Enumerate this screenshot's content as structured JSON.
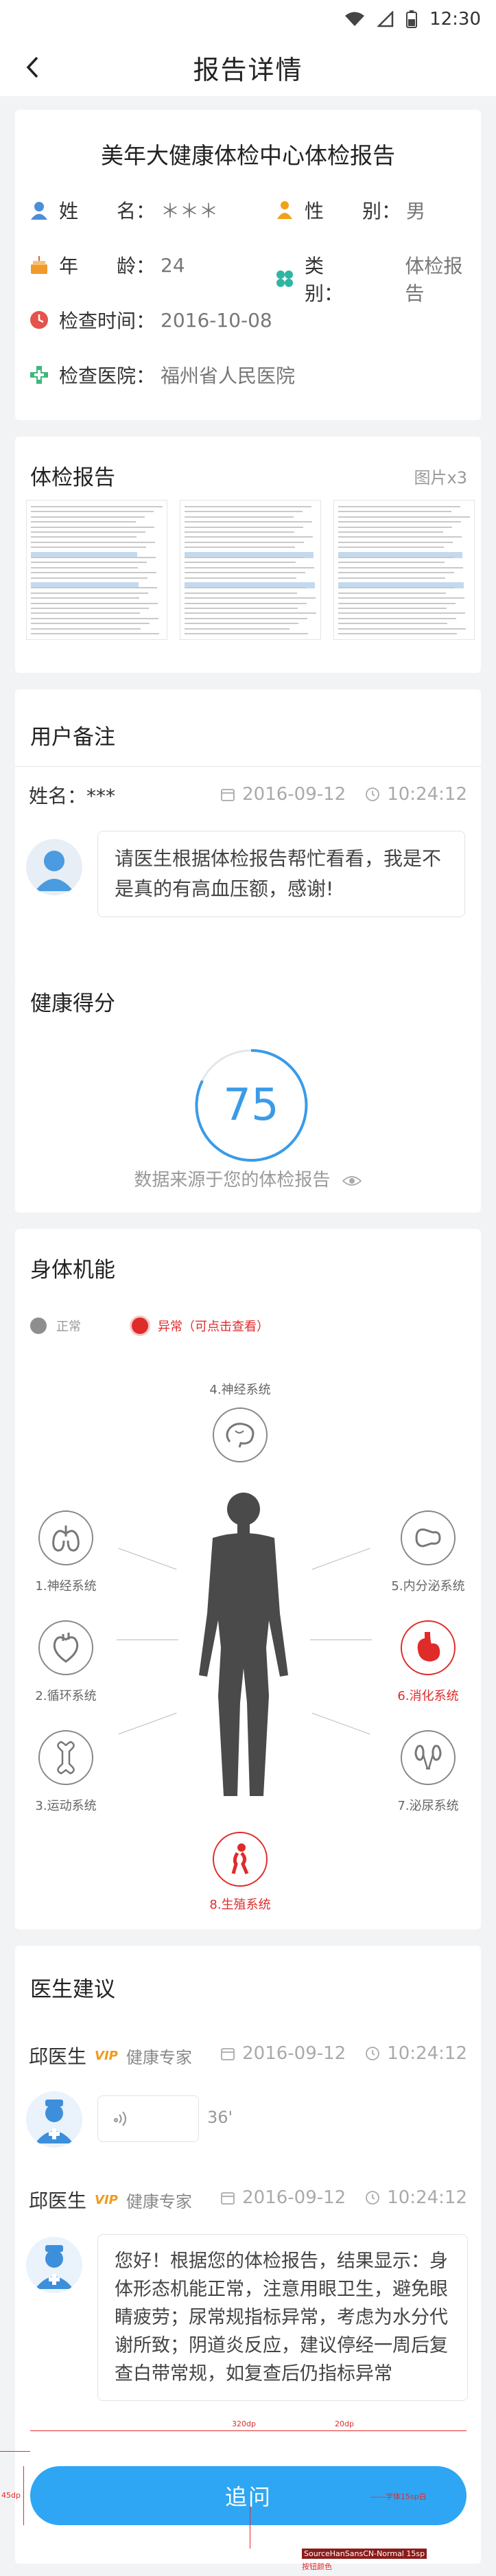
{
  "status_bar": {
    "time": "12:30"
  },
  "nav": {
    "title": "报告详情"
  },
  "report": {
    "title": "美年大健康体检中心体检报告",
    "name_label": "姓　　名：",
    "name_value": "＊＊＊",
    "gender_label": "性　　别：",
    "gender_value": "男",
    "age_label": "年　　龄：",
    "age_value": "24",
    "type_label": "类　　别：",
    "type_value": "体检报告",
    "date_label": "检查时间：",
    "date_value": "2016-10-08",
    "hospital_label": "检查医院：",
    "hospital_value": "福州省人民医院"
  },
  "images": {
    "title": "体检报告",
    "count": "图片x3"
  },
  "remark": {
    "title": "用户备注",
    "name": "姓名：***",
    "date": "2016-09-12",
    "time": "10:24:12",
    "text": "请医生根据体检报告帮忙看看，我是不是真的有高血压额，感谢!"
  },
  "score": {
    "title": "健康得分",
    "value": "75",
    "source": "数据来源于您的体检报告"
  },
  "body": {
    "title": "身体机能",
    "legend_normal": "正常",
    "legend_abnormal": "异常（可点击查看）",
    "systems": {
      "top": "4.神经系统",
      "l1": "1.神经系统",
      "l2": "2.循环系统",
      "l3": "3.运动系统",
      "r1": "5.内分泌系统",
      "r2": "6.消化系统",
      "r3": "7.泌尿系统",
      "bottom": "8.生殖系统"
    },
    "colors": {
      "normal": "#888888",
      "abnormal": "#e02b2b"
    }
  },
  "advice": {
    "title": "医生建议",
    "doctor_name": "邱医生",
    "vip": "VIP",
    "doctor_title": "健康专家",
    "date": "2016-09-12",
    "time": "10:24:12",
    "voice_duration": "36'",
    "doctor_name_2": "邱医生",
    "vip_2": "VIP",
    "doctor_title_2": "健康专家",
    "date_2": "2016-09-12",
    "time_2": "10:24:12",
    "text": "您好！根据您的体检报告，结果显示：身体形态机能正常，注意用眼卫生，避免眼睛疲劳；尿常规指标异常，考虑为水分代谢所致；阴道炎反应，建议停经一周后复查白带常规，如复查后仍指标异常"
  },
  "button": {
    "label": "追问"
  },
  "annotations": {
    "width": "320dp",
    "gap": "20dp",
    "height": "45dp",
    "note1": "——字体15sp白",
    "note2": "SourceHanSansCN-Normal 15sp",
    "note3": "按钮颜色"
  }
}
